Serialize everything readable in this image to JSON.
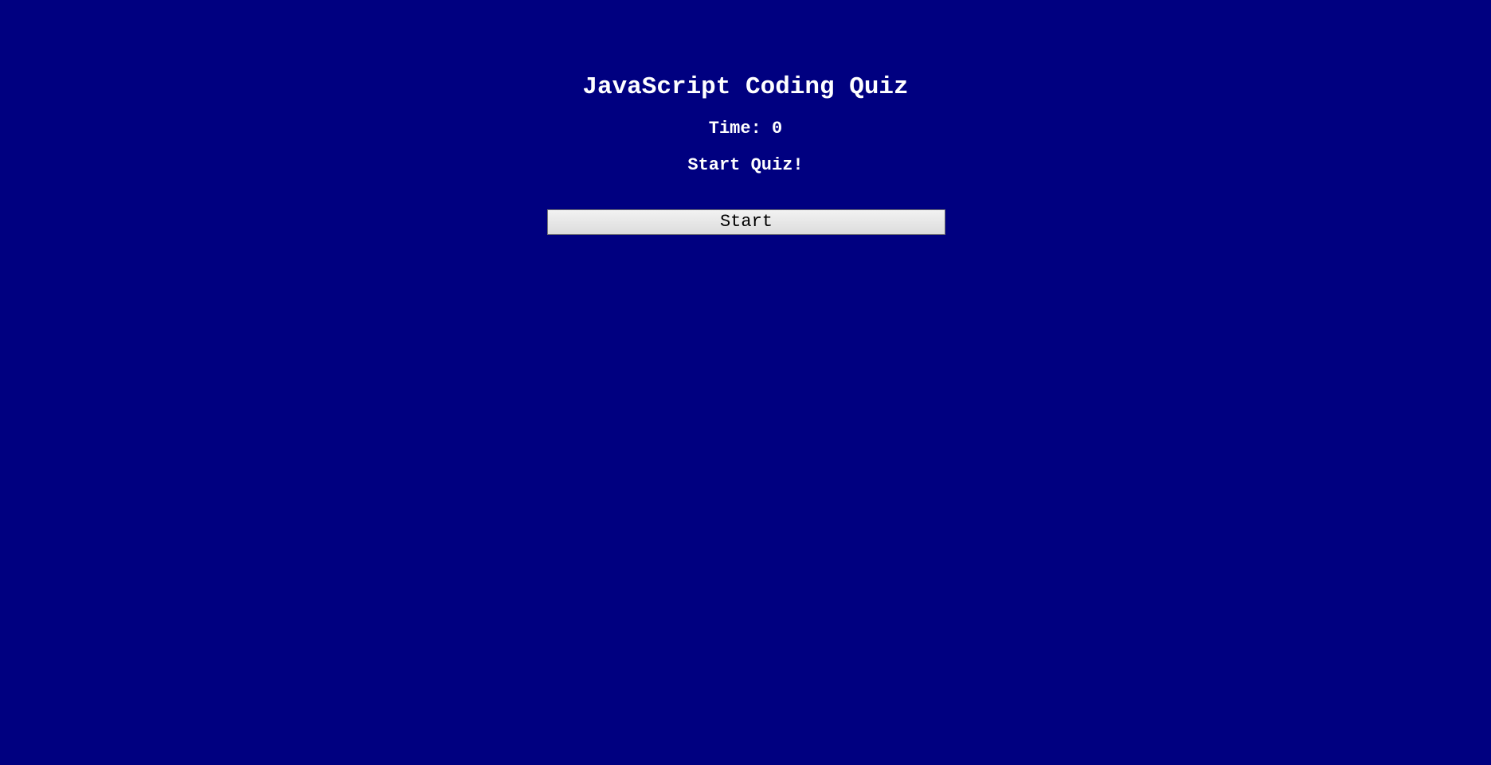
{
  "quiz": {
    "title": "JavaScript Coding Quiz",
    "timer_text": "Time: 0",
    "prompt": "Start Quiz!",
    "start_label": "Start"
  },
  "colors": {
    "background": "#000080",
    "text": "#ffffff",
    "button_text": "#000000"
  }
}
